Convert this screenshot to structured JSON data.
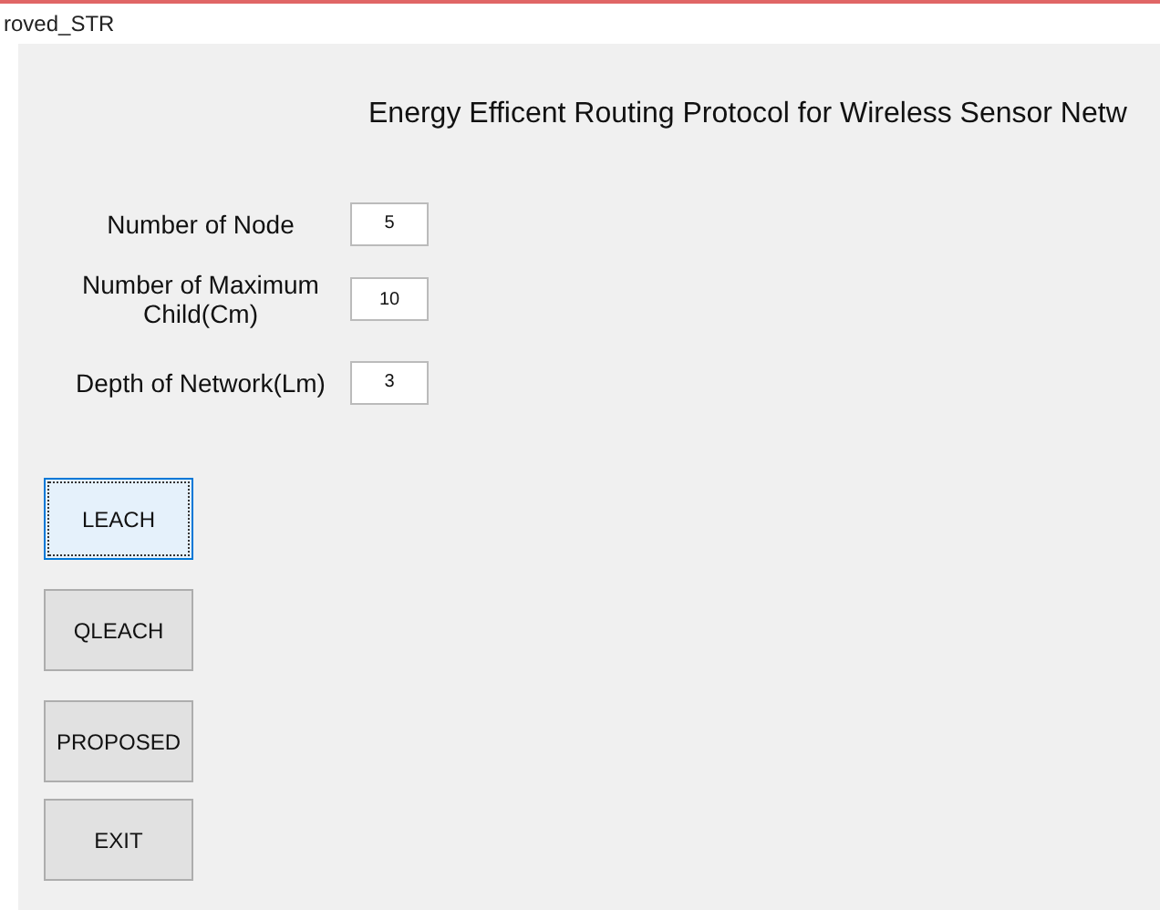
{
  "window": {
    "title": "roved_STR"
  },
  "heading": "Energy Efficent Routing Protocol for Wireless Sensor Netw",
  "fields": [
    {
      "label": "Number of Node",
      "value": "5"
    },
    {
      "label": "Number of Maximum Child(Cm)",
      "value": "10"
    },
    {
      "label": "Depth of Network(Lm)",
      "value": "3"
    }
  ],
  "buttons": [
    {
      "label": "LEACH",
      "selected": true
    },
    {
      "label": "QLEACH",
      "selected": false
    },
    {
      "label": "PROPOSED",
      "selected": false
    },
    {
      "label": "EXIT",
      "selected": false
    }
  ]
}
